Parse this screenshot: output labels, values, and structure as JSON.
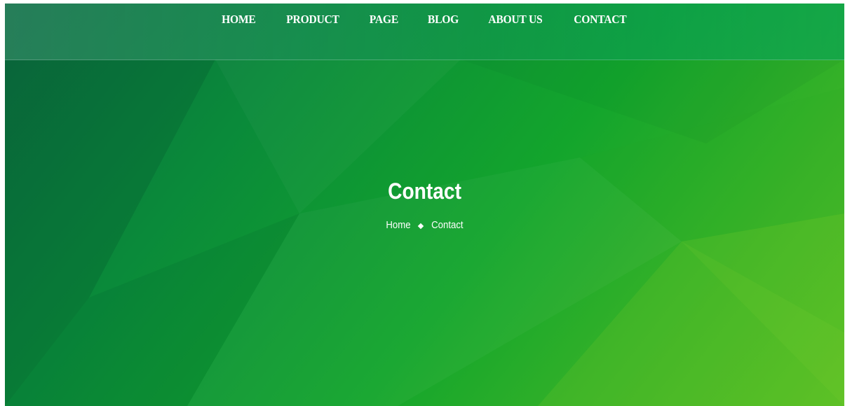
{
  "nav": {
    "items": [
      {
        "label": "HOME"
      },
      {
        "label": "PRODUCT"
      },
      {
        "label": "PAGE"
      },
      {
        "label": "BLOG"
      },
      {
        "label": "ABOUT US"
      },
      {
        "label": "CONTACT"
      }
    ]
  },
  "hero": {
    "title": "Contact",
    "breadcrumb": {
      "home": "Home",
      "current": "Contact",
      "separator_icon": "diamond-icon"
    }
  },
  "colors": {
    "background_dark": "#0b6b40",
    "background_mid": "#13a52c",
    "background_light": "#57bf26",
    "text": "#ffffff"
  }
}
